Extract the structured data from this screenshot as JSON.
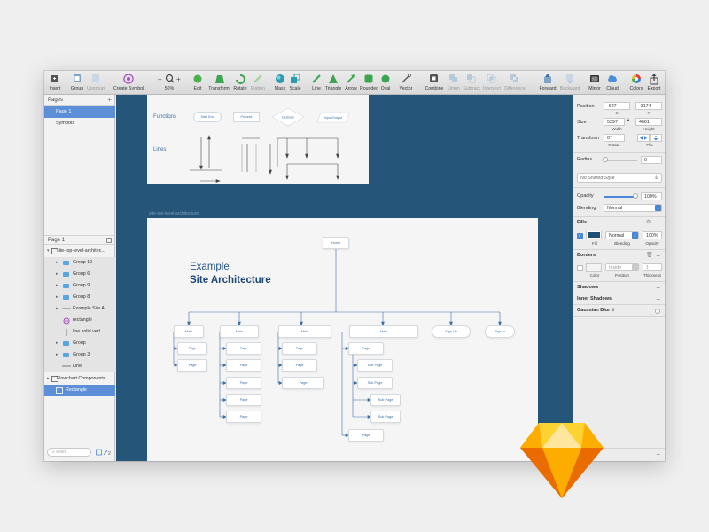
{
  "toolbar": {
    "items": [
      {
        "label": "Insert",
        "icon": "insert-icon"
      },
      {
        "label": "Group",
        "icon": "group-icon"
      },
      {
        "label": "Ungroup",
        "icon": "ungroup-icon",
        "dim": true
      },
      {
        "label": "Create Symbol",
        "icon": "create-symbol-icon"
      },
      {
        "label": "50%",
        "icon": "zoom-icon"
      },
      {
        "label": "Edit",
        "icon": "edit-icon"
      },
      {
        "label": "Transform",
        "icon": "transform-icon"
      },
      {
        "label": "Rotate",
        "icon": "rotate-icon"
      },
      {
        "label": "Flatten",
        "icon": "flatten-icon",
        "dim": true
      },
      {
        "label": "Mask",
        "icon": "mask-icon"
      },
      {
        "label": "Scale",
        "icon": "scale-icon"
      },
      {
        "label": "Line",
        "icon": "line-icon"
      },
      {
        "label": "Triangle",
        "icon": "triangle-icon"
      },
      {
        "label": "Arrow",
        "icon": "arrow-icon"
      },
      {
        "label": "Rounded",
        "icon": "rounded-icon"
      },
      {
        "label": "Oval",
        "icon": "oval-icon"
      },
      {
        "label": "Vector",
        "icon": "vector-icon"
      },
      {
        "label": "Combine",
        "icon": "combine-icon"
      },
      {
        "label": "Union",
        "icon": "union-icon",
        "dim": true
      },
      {
        "label": "Subtract",
        "icon": "subtract-icon",
        "dim": true
      },
      {
        "label": "Intersect",
        "icon": "intersect-icon",
        "dim": true
      },
      {
        "label": "Difference",
        "icon": "difference-icon",
        "dim": true
      },
      {
        "label": "Forward",
        "icon": "forward-icon"
      },
      {
        "label": "Backward",
        "icon": "backward-icon",
        "dim": true
      },
      {
        "label": "Mirror",
        "icon": "mirror-icon"
      },
      {
        "label": "Cloud",
        "icon": "cloud-icon"
      },
      {
        "label": "Colors",
        "icon": "colors-icon"
      },
      {
        "label": "Export",
        "icon": "export-icon"
      }
    ]
  },
  "pages": {
    "title": "Pages",
    "items": [
      "Page 1",
      "Symbols"
    ],
    "selected": "Page 1"
  },
  "layers": {
    "page_label": "Page 1",
    "items": [
      {
        "label": "site-top-level-architec...",
        "type": "artboard"
      },
      {
        "label": "Group 10",
        "type": "folder"
      },
      {
        "label": "Group 6",
        "type": "folder"
      },
      {
        "label": "Group 9",
        "type": "folder"
      },
      {
        "label": "Group 8",
        "type": "folder"
      },
      {
        "label": "Example Site A...",
        "type": "text"
      },
      {
        "label": "rectangle",
        "type": "symbol"
      },
      {
        "label": "line solid vert",
        "type": "line"
      },
      {
        "label": "Group",
        "type": "folder"
      },
      {
        "label": "Group 3",
        "type": "folder"
      },
      {
        "label": "Line",
        "type": "line"
      },
      {
        "label": "Flowchart Components",
        "type": "artboard"
      },
      {
        "label": "Rectangle",
        "type": "rectangle"
      }
    ],
    "filter_placeholder": "Filter"
  },
  "canvas": {
    "artboard1": {
      "functions_label": "Functions",
      "lines_label": "Lines",
      "shapes": [
        "Start End",
        "Process",
        "Decision",
        "Input/Output"
      ]
    },
    "artboard2": {
      "name": "site-top-level-architecture",
      "title_line1": "Example",
      "title_line2": "Site Architecture",
      "home": "Home",
      "mains": [
        "Main",
        "Main",
        "Main",
        "Main"
      ],
      "signup": "Sign Up",
      "signin": "Sign In",
      "page": "Page",
      "subpage": "Sub Page"
    }
  },
  "inspector": {
    "position_label": "Position",
    "x": "-627",
    "y": "-3174",
    "x_label": "X",
    "y_label": "Y",
    "size_label": "Size",
    "width": "5397",
    "height": "4661",
    "width_label": "Width",
    "height_label": "Height",
    "transform_label": "Transform",
    "rotate": "0°",
    "rotate_label": "Rotate",
    "flip_label": "Flip",
    "radius_label": "Radius",
    "radius": "0",
    "shared_style": "No Shared Style",
    "opacity_label": "Opacity",
    "opacity": "100%",
    "opacity_fraction": 1.0,
    "blending_label": "Blending",
    "blending": "Normal",
    "fills_label": "Fills",
    "fill_color": "#1f5176",
    "fill_blending": "Normal",
    "fill_opacity": "100%",
    "fill_label": "Fill",
    "fill_blending_label": "Blending",
    "fill_opacity_label": "Opacity",
    "borders_label": "Borders",
    "border_position": "Inside",
    "border_thickness": "1",
    "color_label": "Color",
    "position_sub_label": "Position",
    "thickness_label": "Thickness",
    "shadows_label": "Shadows",
    "inner_shadows_label": "Inner Shadows",
    "gaussian_blur_label": "Gaussian Blur"
  },
  "colors": {
    "canvas": "#255579",
    "selection": "#5d8fd9",
    "accent": "#3b6ea5"
  }
}
